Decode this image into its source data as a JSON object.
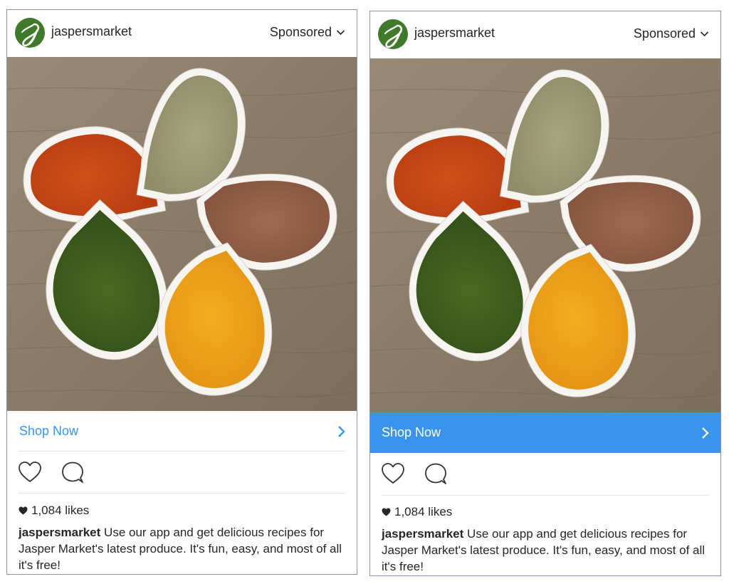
{
  "ads": [
    {
      "variant": "default",
      "account": {
        "username": "jaspersmarket",
        "avatar_letter": "J",
        "avatar_color": "#3f7a2a"
      },
      "sponsored_label": "Sponsored",
      "image": {
        "description": "Five teardrop white bowls of spices arranged as a flower on a wooden table",
        "spices": [
          "paprika",
          "fennel seeds",
          "flax seeds",
          "dried dill",
          "turmeric"
        ]
      },
      "cta": {
        "label": "Shop Now",
        "style": "text",
        "color": "#3897f0"
      },
      "likes_label": "1,084 likes",
      "caption": {
        "username": "jaspersmarket",
        "text": "Use our app and get delicious recipes for Jasper Market's latest produce. It's fun, easy, and most of all it's free!"
      }
    },
    {
      "variant": "highlighted-cta",
      "account": {
        "username": "jaspersmarket",
        "avatar_letter": "J",
        "avatar_color": "#3f7a2a"
      },
      "sponsored_label": "Sponsored",
      "image": {
        "description": "Five teardrop white bowls of spices arranged as a flower on a wooden table",
        "spices": [
          "paprika",
          "fennel seeds",
          "flax seeds",
          "dried dill",
          "turmeric"
        ]
      },
      "cta": {
        "label": "Shop Now",
        "style": "filled",
        "color": "#3a93ec"
      },
      "likes_label": "1,084 likes",
      "caption": {
        "username": "jaspersmarket",
        "text": "Use our app and get delicious recipes for Jasper Market's latest produce. It's fun, easy, and most of all it's free!"
      }
    }
  ],
  "icons": {
    "avatar": "jasper-market-logo-icon",
    "sponsored": "chevron-down-icon",
    "cta": "chevron-right-icon",
    "like": "heart-outline-icon",
    "comment": "comment-bubble-icon",
    "likes": "heart-filled-icon"
  }
}
